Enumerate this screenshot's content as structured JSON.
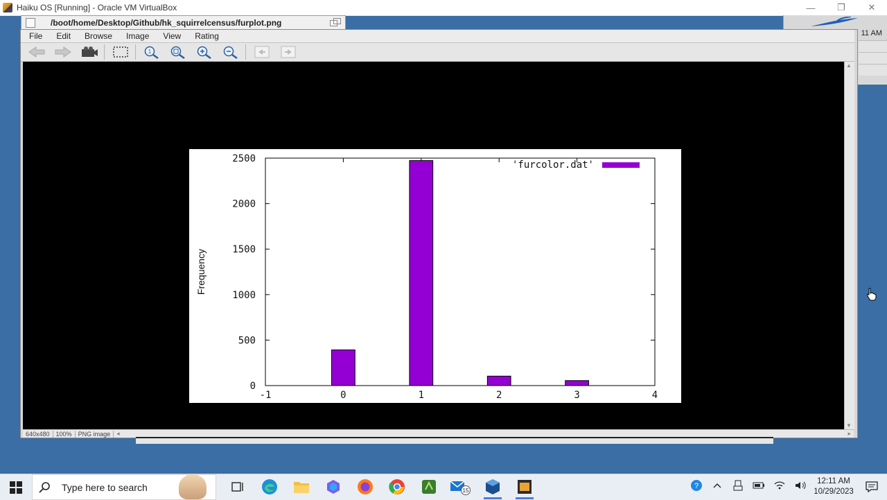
{
  "host_window": {
    "title": "Haiku OS  [Running] - Oracle VM VirtualBox",
    "minimize": "—",
    "restore": "❐",
    "close": "✕"
  },
  "haiku_desktop": {
    "clock_partial": "11 AM"
  },
  "viewer": {
    "path": "/boot/home/Desktop/Github/hk_squirrelcensus/furplot.png",
    "menu": [
      "File",
      "Edit",
      "Browse",
      "Image",
      "View",
      "Rating"
    ],
    "toolbar_icons": [
      "back-arrow-icon",
      "forward-arrow-icon",
      "slideshow-icon",
      "selection-icon",
      "original-size-icon",
      "fit-window-icon",
      "zoom-in-icon",
      "zoom-out-icon",
      "previous-page-icon",
      "next-page-icon"
    ],
    "status": {
      "dimensions": "640x480",
      "zoom": "100%",
      "type": "PNG image"
    }
  },
  "chart_data": {
    "type": "bar",
    "title": "",
    "xlabel": "",
    "ylabel": "Frequency",
    "legend": "'furcolor.dat'",
    "legend_position": "top-right",
    "xlim": [
      -1,
      4
    ],
    "ylim": [
      0,
      2500
    ],
    "x_ticks": [
      "-1",
      "0",
      "1",
      "2",
      "3",
      "4"
    ],
    "y_ticks": [
      "0",
      "500",
      "1000",
      "1500",
      "2000",
      "2500"
    ],
    "x": [
      0,
      1,
      2,
      3
    ],
    "values": [
      392,
      2473,
      104,
      55
    ],
    "bar_color": "#9400d3",
    "grid": false
  },
  "taskbar": {
    "search_placeholder": "Type here to search",
    "mail_badge": "15",
    "time": "12:11 AM",
    "date": "10/29/2023"
  }
}
